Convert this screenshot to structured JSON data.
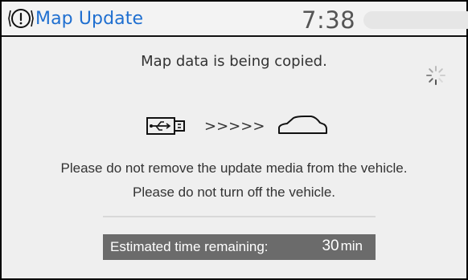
{
  "header": {
    "title": "Map Update",
    "time": "7:38",
    "icon": "warning-circle-icon",
    "title_color": "#1f6fd0"
  },
  "message": {
    "main": "Map data is being copied.",
    "line1": "Please do not remove the update media from the vehicle.",
    "line2": "Please do not turn off the vehicle."
  },
  "process": {
    "source_icon": "usb-drive-icon",
    "arrows": ">>>>>",
    "target_icon": "car-outline-icon"
  },
  "spinner": {
    "icon": "loading-spinner-icon"
  },
  "estimate": {
    "label": "Estimated time remaining:",
    "value": "30",
    "unit": "min",
    "bar_color": "#6b6b6b"
  }
}
